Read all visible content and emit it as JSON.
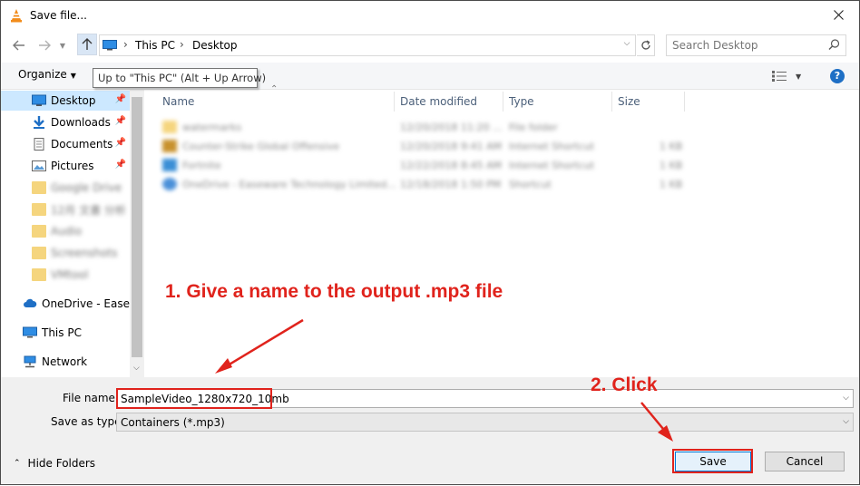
{
  "window": {
    "title": "Save file..."
  },
  "address": {
    "crumbs": [
      "This PC",
      "Desktop"
    ],
    "search_placeholder": "Search Desktop"
  },
  "toolbar": {
    "organize_label": "Organize",
    "tooltip": "Up to \"This PC\" (Alt + Up Arrow)"
  },
  "sidebar": {
    "items": [
      {
        "label": "Desktop",
        "icon": "desktop-icon",
        "pinned": true,
        "selected": true
      },
      {
        "label": "Downloads",
        "icon": "download-icon",
        "pinned": true
      },
      {
        "label": "Documents",
        "icon": "document-icon",
        "pinned": true
      },
      {
        "label": "Pictures",
        "icon": "pictures-icon",
        "pinned": true
      },
      {
        "label": "Google Drive",
        "icon": "folder-icon",
        "blurred": true
      },
      {
        "label": "12月 文書 分析",
        "icon": "folder-icon",
        "blurred": true
      },
      {
        "label": "Audio",
        "icon": "folder-icon",
        "blurred": true
      },
      {
        "label": "Screenshots",
        "icon": "folder-icon",
        "blurred": true
      },
      {
        "label": "VMtool",
        "icon": "folder-icon",
        "blurred": true
      },
      {
        "label": "OneDrive - Easewa",
        "icon": "cloud-icon"
      },
      {
        "label": "This PC",
        "icon": "computer-icon"
      },
      {
        "label": "Network",
        "icon": "network-icon"
      }
    ]
  },
  "filelist": {
    "columns": [
      "Name",
      "Date modified",
      "Type",
      "Size"
    ],
    "rows": [
      {
        "name": "watermarks",
        "date": "12/20/2018 11:20 ...",
        "type": "File folder",
        "size": ""
      },
      {
        "name": "Counter-Strike Global Offensive",
        "date": "12/20/2018 9:41 AM",
        "type": "Internet Shortcut",
        "size": "1 KB"
      },
      {
        "name": "Fortnite",
        "date": "12/22/2018 8:45 AM",
        "type": "Internet Shortcut",
        "size": "1 KB"
      },
      {
        "name": "OneDrive - Easeware Technology Limited...",
        "date": "12/18/2018 1:50 PM",
        "type": "Shortcut",
        "size": "1 KB"
      }
    ]
  },
  "form": {
    "file_name_label": "File name:",
    "file_name_value": "SampleVideo_1280x720_10mb",
    "save_type_label": "Save as type:",
    "save_type_value": "Containers (*.mp3)",
    "hide_folders_label": "Hide Folders",
    "save_label": "Save",
    "cancel_label": "Cancel"
  },
  "annotations": {
    "step1": "1. Give a name to the output .mp3 file",
    "step2": "2. Click"
  },
  "colors": {
    "accent": "#e0231c",
    "selection": "#cce8ff",
    "help": "#1f6fc5"
  }
}
